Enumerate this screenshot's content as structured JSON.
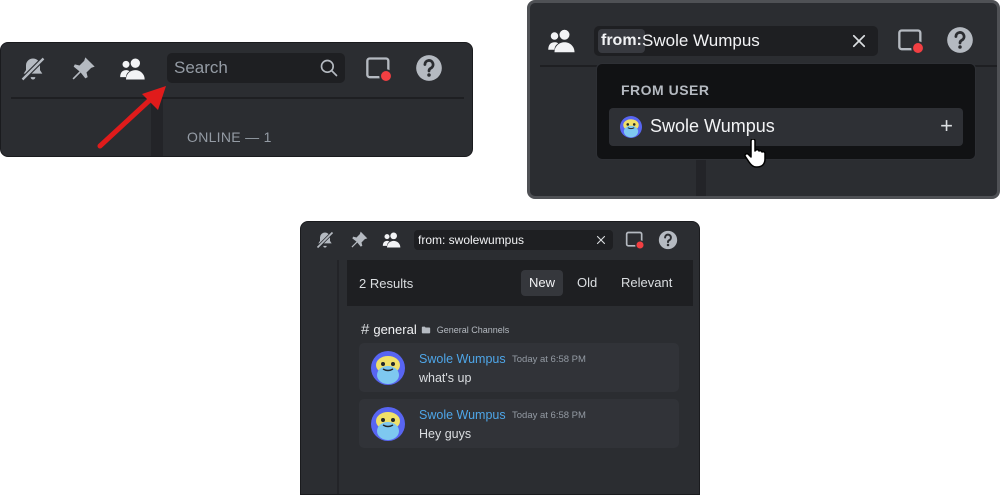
{
  "panel1": {
    "search": {
      "placeholder": "Search"
    },
    "member_list": {
      "header": "ONLINE — 1"
    }
  },
  "panel2": {
    "search": {
      "token": "from:",
      "value": "Swole Wumpus"
    },
    "dropdown": {
      "title": "FROM USER",
      "items": [
        {
          "name": "Swole Wumpus",
          "action": "+"
        }
      ]
    }
  },
  "panel3": {
    "search": {
      "value": "from: swolewumpus"
    },
    "results": {
      "count_label": "2 Results",
      "sort_tabs": [
        {
          "label": "New",
          "active": true
        },
        {
          "label": "Old",
          "active": false
        },
        {
          "label": "Relevant",
          "active": false
        }
      ],
      "channel": {
        "name": "general",
        "category": "General Channels"
      },
      "messages": [
        {
          "author": "Swole Wumpus",
          "timestamp": "Today at 6:58 PM",
          "text": "what's up"
        },
        {
          "author": "Swole Wumpus",
          "timestamp": "Today at 6:58 PM",
          "text": "Hey guys"
        }
      ]
    }
  },
  "icons": [
    "bell-slash-icon",
    "pin-icon",
    "members-icon",
    "search-icon",
    "inbox-icon",
    "help-icon",
    "clear-icon",
    "folder-icon",
    "hash-icon",
    "plus-icon",
    "pointer-cursor-icon",
    "arrow-icon"
  ],
  "colors": {
    "background": "#2b2d31",
    "search_bg": "#1e1f22",
    "dropdown_bg": "#111214",
    "author_link": "#4ea6e8",
    "notification_red": "#f23f42",
    "arrow_red": "#e01b1b"
  }
}
